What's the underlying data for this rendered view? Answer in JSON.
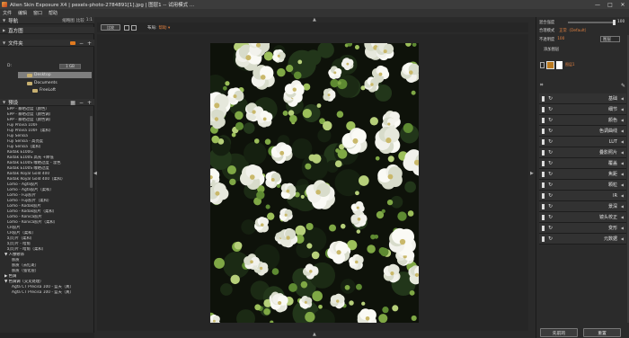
{
  "window": {
    "title": "Alien Skin Exposure X4 | pexels-photo-2784891[1].jpg | 图层1 -- 试用模式 ...",
    "minimize": "—",
    "maximize": "□",
    "close": "✕"
  },
  "menu": [
    "文件",
    "编辑",
    "窗口",
    "帮助"
  ],
  "left": {
    "nav_label": "导航",
    "nav_tabs": [
      "缩略图",
      "比较",
      "1:1"
    ],
    "histogram_label": "直方图",
    "folders_label": "文件夹",
    "path_drive": "D:",
    "path_size": "1 GB",
    "tree": [
      "Desktop",
      "Documents",
      "FreeLoft"
    ],
    "presets_label": "预设",
    "presets": [
      "EPP - 暴晒过度（颜色）",
      "EPP - 暴晒过度（颜色调）",
      "EPP - 暴晒过度（颜色调）",
      "Fuji Provia 100F",
      "Fuji Provia 100F（柔和）",
      "Fuji Sensia",
      "Fuji Sensia - 高亮度",
      "Fuji Sensia（柔和）",
      "Kodak E100G",
      "Kodak E100S 高光 +降低",
      "Kodak E100S 曝晒过度 - 温色",
      "Kodak E100S 曝晒过度",
      "Kodak Royal Gold 400",
      "Kodak Royal Gold 400（柔和）",
      "Lomo - Agfa胶片",
      "Lomo - Agfa胶片（柔和）",
      "Lomo - Fuji胶片",
      "Lomo - Fuji胶片（柔和）",
      "Lomo - Kodak胶片",
      "Lomo - Kodak胶片（柔和）",
      "Lomo - Konica胶片",
      "Lomo - Konica胶片（柔和）",
      "CR胶片",
      "CR胶片（柔和）",
      "幻灯片（柔和）",
      "幻灯片 - 暗角",
      "幻灯片 - 暗角（柔和）"
    ],
    "groups": [
      {
        "label": "人像修饰",
        "items": [
          "肤质",
          "肤质（去红斑）",
          "肤质（强化层）"
        ]
      },
      {
        "label": "色调",
        "items": []
      },
      {
        "label": "色调调（交叉处理）",
        "items": [
          "Agfa CT Precisa 100 - 蓝天（真）",
          "Agfa CT Precisa 100 - 蓝天（真）"
        ]
      }
    ]
  },
  "center": {
    "compare_label": "比较",
    "zoom_label": "布局:",
    "zoom_value": "帮助 ▾"
  },
  "right": {
    "opacity_label": "混合强度",
    "opacity_value": "100",
    "opacity_fraction": 1.0,
    "blend_label": "合理模式",
    "blend_value": "正常（Default）",
    "transparency_label": "不透明度",
    "transparency_value": "100",
    "layer_dropdown": "图层",
    "layer_section": "添加图层",
    "layer_name": "图层1",
    "adjustments": [
      "基础",
      "细节",
      "颜色",
      "色调曲线",
      "LUT",
      "叠影照片",
      "覆盖",
      "焦距",
      "颗粒",
      "IR",
      "景深",
      "镜头校正",
      "变形",
      "元数据"
    ],
    "prev_button": "先前的",
    "reset_button": "重置"
  }
}
